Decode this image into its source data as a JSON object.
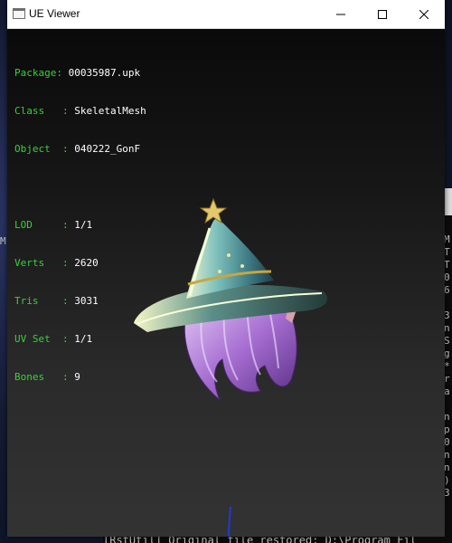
{
  "window": {
    "title": "UE Viewer",
    "icon": "window-app-icon"
  },
  "controls": {
    "minimize": "minimize-icon",
    "maximize": "maximize-icon",
    "close": "close-icon"
  },
  "info": {
    "package": {
      "label": "Package",
      "value": "00035987.upk"
    },
    "class": {
      "label": "Class",
      "value": "SkeletalMesh"
    },
    "object": {
      "label": "Object",
      "value": "040222_GonF"
    },
    "lod": {
      "label": "LOD",
      "value": "1/1"
    },
    "verts": {
      "label": "Verts",
      "value": "2620"
    },
    "tris": {
      "label": "Tris",
      "value": "3031"
    },
    "uvset": {
      "label": "UV Set",
      "value": "1/1"
    },
    "bones": {
      "label": "Bones",
      "value": "9"
    }
  },
  "colors": {
    "label": "#36d336",
    "value": "#ffffff",
    "hat": "#5a9ea0",
    "hair": "#b27ad8"
  },
  "console": {
    "left_fragment": "M",
    "right_column": [
      "M",
      "T",
      "T",
      "0",
      "6",
      "",
      "3",
      "n",
      "S",
      "g",
      "*",
      "r",
      "a",
      "",
      "n",
      "p",
      "0",
      "n",
      "n",
      ")",
      "3"
    ],
    "bottom_line": "[RstUtil] Original file restored: D:\\Program Fil"
  }
}
